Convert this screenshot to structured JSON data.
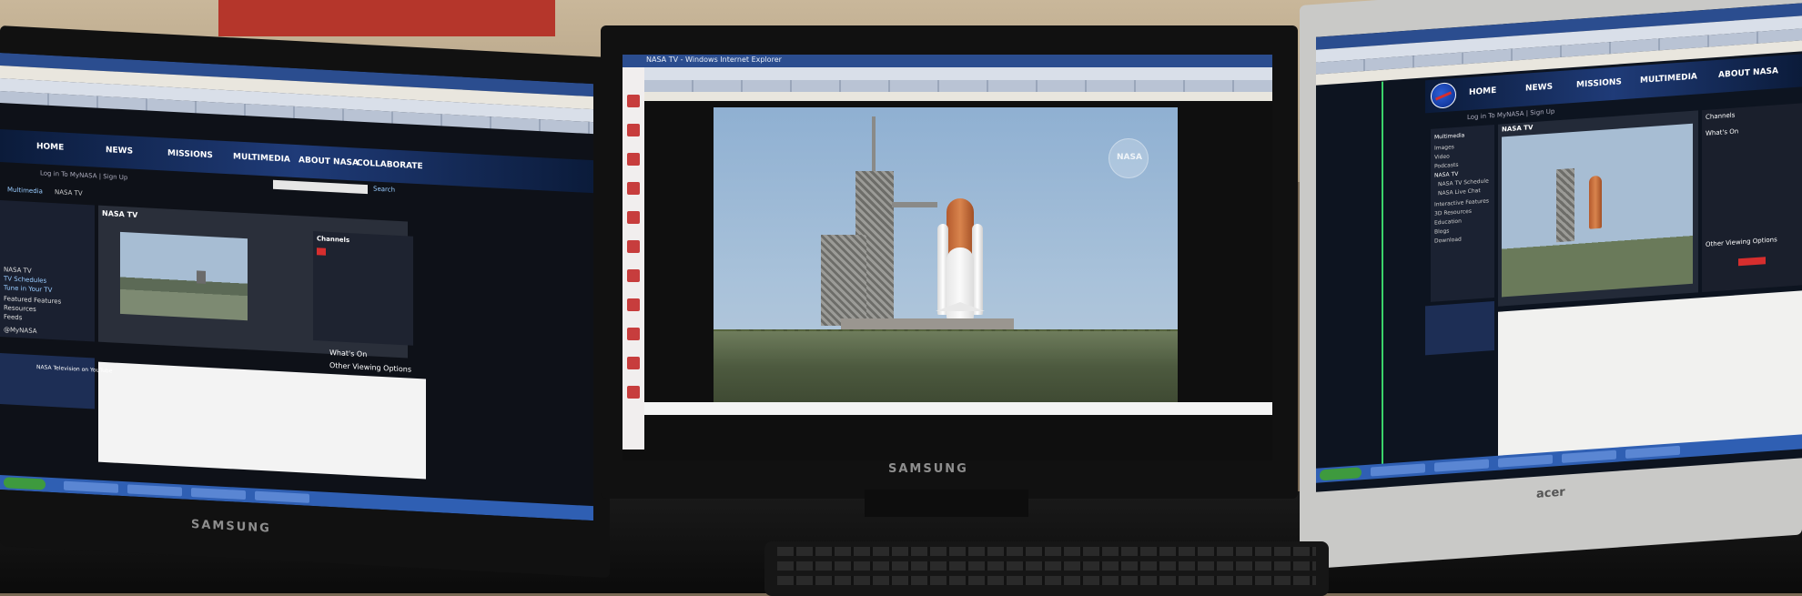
{
  "left_monitor": {
    "brand": "SAMSUNG",
    "nav": [
      "HOME",
      "NEWS",
      "MISSIONS",
      "MULTIMEDIA",
      "ABOUT NASA",
      "COLLABORATE"
    ],
    "login": "Log in To MyNASA | Sign Up",
    "search_button": "Search",
    "breadcrumb": "Multimedia",
    "breadcrumb_current": "NASA TV",
    "section_title": "NASA TV",
    "channels_title": "Channels",
    "sidebar_links": [
      "NASA TV",
      "TV Schedules",
      "Tune in Your TV",
      "Featured Features",
      "Resources",
      "Feeds",
      "@MyNASA"
    ],
    "whats_on": "What's On",
    "other_options": "Other Viewing Options",
    "social_heading": "NASA Television on YouTube"
  },
  "center_monitor": {
    "brand": "SAMSUNG",
    "window_title": "NASA TV - Windows Internet Explorer",
    "watermark": "NASA"
  },
  "right_monitor": {
    "brand": "acer",
    "nav": [
      "HOME",
      "NEWS",
      "MISSIONS",
      "MULTIMEDIA",
      "ABOUT NASA"
    ],
    "login": "Log in To MyNASA | Sign Up",
    "section_title": "NASA TV",
    "sidebar_links": [
      "Multimedia",
      "Images",
      "Video",
      "Podcasts",
      "NASA TV",
      "NASA TV Schedule",
      "NASA Live Chat",
      "Interactive Features",
      "3D Resources",
      "Education",
      "Blogs",
      "Download"
    ],
    "channels_title": "Channels",
    "whats_on": "What's On",
    "other_options": "Other Viewing Options"
  },
  "colors": {
    "nasa_navy": "#0b1b3a",
    "nasa_red": "#d62e2e",
    "taskbar_blue": "#2f5fb3"
  }
}
